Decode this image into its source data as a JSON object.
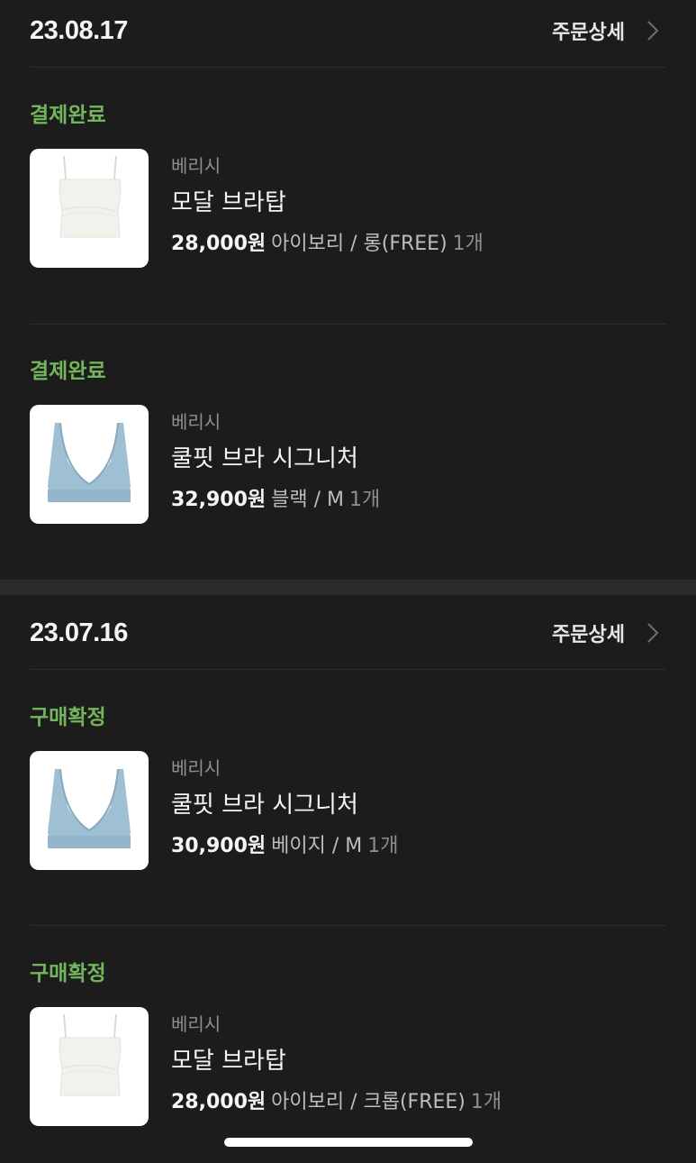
{
  "orders": [
    {
      "date": "23.08.17",
      "detail_label": "주문상세",
      "items": [
        {
          "status": "결제완료",
          "brand": "베리시",
          "name": "모달 브라탑",
          "price": "28,000원",
          "option": "아이보리 / 롱(FREE)",
          "qty": "1개",
          "thumb": "ivory-bratop"
        },
        {
          "status": "결제완료",
          "brand": "베리시",
          "name": "쿨핏 브라 시그니처",
          "price": "32,900원",
          "option": "블랙 / M",
          "qty": "1개",
          "thumb": "blue-bra"
        }
      ]
    },
    {
      "date": "23.07.16",
      "detail_label": "주문상세",
      "items": [
        {
          "status": "구매확정",
          "brand": "베리시",
          "name": "쿨핏 브라 시그니처",
          "price": "30,900원",
          "option": "베이지 / M",
          "qty": "1개",
          "thumb": "blue-bra"
        },
        {
          "status": "구매확정",
          "brand": "베리시",
          "name": "모달 브라탑",
          "price": "28,000원",
          "option": "아이보리 / 크롭(FREE)",
          "qty": "1개",
          "thumb": "ivory-bratop"
        }
      ]
    }
  ],
  "colors": {
    "background": "#1c1c1c",
    "status_green": "#73b55c",
    "divider": "#2c2c2c",
    "section_gap": "#2a2a2a"
  },
  "icons": {
    "detail_chevron": "chevron-right-icon"
  }
}
